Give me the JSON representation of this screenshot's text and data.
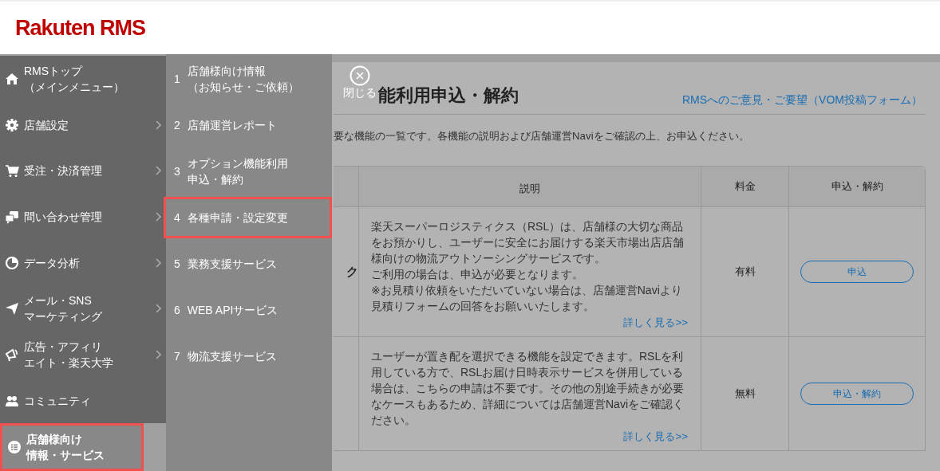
{
  "header": {
    "logo": "Rakuten RMS"
  },
  "nav": {
    "items": [
      {
        "lines": [
          "RMSトップ",
          "（メインメニュー）"
        ],
        "expandable": false,
        "selected": false
      },
      {
        "lines": [
          "店舗設定"
        ],
        "expandable": true,
        "selected": false
      },
      {
        "lines": [
          "受注・決済管理"
        ],
        "expandable": true,
        "selected": false
      },
      {
        "lines": [
          "問い合わせ管理"
        ],
        "expandable": true,
        "selected": false
      },
      {
        "lines": [
          "データ分析"
        ],
        "expandable": true,
        "selected": false
      },
      {
        "lines": [
          "メール・SNS",
          "マーケティング"
        ],
        "expandable": true,
        "selected": false
      },
      {
        "lines": [
          "広告・アフィリ",
          "エイト・楽天大学"
        ],
        "expandable": true,
        "selected": false
      },
      {
        "lines": [
          "コミュニティ"
        ],
        "expandable": false,
        "selected": false
      },
      {
        "lines": [
          "店舗様向け",
          "情報・サービス"
        ],
        "expandable": false,
        "selected": true
      }
    ]
  },
  "subnav": {
    "items": [
      {
        "number": "1",
        "lines": [
          "店舗様向け情報",
          "（お知らせ・ご依頼）"
        ],
        "selected": false
      },
      {
        "number": "2",
        "lines": [
          "店舗運営レポート"
        ],
        "selected": false
      },
      {
        "number": "3",
        "lines": [
          "オプション機能利用",
          "申込・解約"
        ],
        "selected": false
      },
      {
        "number": "4",
        "lines": [
          "各種申請・設定変更"
        ],
        "selected": true
      },
      {
        "number": "5",
        "lines": [
          "業務支援サービス"
        ],
        "selected": false
      },
      {
        "number": "6",
        "lines": [
          "WEB APIサービス"
        ],
        "selected": false
      },
      {
        "number": "7",
        "lines": [
          "物流支援サービス"
        ],
        "selected": false
      }
    ]
  },
  "close_button": {
    "label": "閉じる"
  },
  "main": {
    "title": "能利用申込・解約",
    "feedback_link": "RMSへのご意見・ご要望（VOM投稿フォーム）",
    "description": "要な機能の一覧です。各機能の説明および店舗運営Naviをご確認の上、お申込ください。",
    "table": {
      "columns": [
        "説明",
        "料金",
        "申込・解約"
      ],
      "rows": [
        {
          "column_1": "ク",
          "description": [
            "楽天スーパーロジスティクス（RSL）は、店舗様の大切な商品をお預かりし、ユーザーに安全にお届けする楽天市場出店店舗様向けの物流アウトソーシングサービスです。",
            "ご利用の場合は、申込が必要となります。",
            "※お見積り依頼をいただいていない場合は、店舗運営Naviより見積りフォームの回答をお願いいたします。"
          ],
          "more_link": "詳しく見る>>",
          "fee": "有料",
          "action": "申込"
        },
        {
          "description": [
            "ユーザーが置き配を選択できる機能を設定できます。RSLを利用している方で、RSLお届け日時表示サービスを併用している場合は、こちらの申請は不要です。その他の別途手続きが必要なケースもあるため、詳細については店舗運営Naviをご確認ください。"
          ],
          "more_link": "詳しく見る>>",
          "fee": "無料",
          "action": "申込・解約"
        }
      ]
    }
  }
}
